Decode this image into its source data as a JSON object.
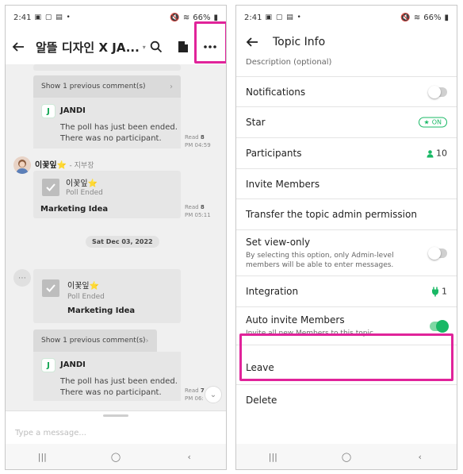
{
  "left": {
    "status": {
      "time": "2:41",
      "battery": "66%"
    },
    "header": {
      "title": "알뜰 디자인 X JA..."
    },
    "comments": {
      "show_prev_1": "Show 1 previous comment(s)",
      "show_prev_2": "Show 1 previous comment(s)",
      "bot_name": "JANDI",
      "bot_msg_line1": "The poll has just been ended.",
      "bot_msg_line2": "There was no participant."
    },
    "msg1_meta": {
      "read_label": "Read",
      "read_count": "8",
      "time": "PM 04:59"
    },
    "sender": {
      "name": "이꽃잎⭐",
      "role": "- 지부장"
    },
    "poll1": {
      "name": "이꽃잎⭐",
      "status": "Poll Ended",
      "title": "Marketing Idea"
    },
    "msg2_meta": {
      "read_label": "Read",
      "read_count": "8",
      "time": "PM 05:11"
    },
    "date_divider": "Sat Dec 03, 2022",
    "poll2": {
      "name": "이꽃잎⭐",
      "status": "Poll Ended",
      "title": "Marketing Idea"
    },
    "msg3_meta": {
      "read_label": "Read",
      "read_count": "7",
      "time": "PM 06:"
    },
    "composer_placeholder": "Type a message..."
  },
  "right": {
    "status": {
      "time": "2:41",
      "battery": "66%"
    },
    "header": {
      "title": "Topic Info"
    },
    "description_placeholder": "Description (optional)",
    "notifications": {
      "label": "Notifications",
      "enabled": false
    },
    "star": {
      "label": "Star",
      "value": "ON"
    },
    "participants": {
      "label": "Participants",
      "count": "10"
    },
    "invite": {
      "label": "Invite Members"
    },
    "transfer": {
      "label": "Transfer the topic admin permission"
    },
    "view_only": {
      "label": "Set view-only",
      "desc": "By selecting this option, only Admin-level members will be able to enter messages.",
      "enabled": false
    },
    "integration": {
      "label": "Integration",
      "count": "1"
    },
    "auto_invite": {
      "label": "Auto invite Members",
      "desc": "Invite all new Members to this topic.",
      "enabled": true
    },
    "leave": {
      "label": "Leave"
    },
    "delete": {
      "label": "Delete"
    }
  },
  "icons": {
    "back": "arrow-left-icon",
    "search": "search-icon",
    "file": "file-icon",
    "more": "more-horizontal-icon",
    "participant": "person-icon",
    "integration": "plug-icon",
    "star": "star-icon"
  },
  "colors": {
    "accent_green": "#19b865",
    "highlight_pink": "#e0239a",
    "jandi_green": "#10a551"
  }
}
